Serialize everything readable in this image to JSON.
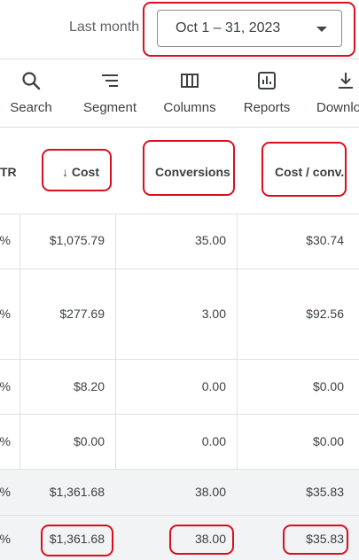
{
  "topbar": {
    "period_label": "Last month",
    "date_range": "Oct 1 – 31, 2023"
  },
  "toolbar": {
    "items": [
      {
        "label": "Search",
        "icon": "search-icon"
      },
      {
        "label": "Segment",
        "icon": "segment-icon"
      },
      {
        "label": "Columns",
        "icon": "columns-icon"
      },
      {
        "label": "Reports",
        "icon": "reports-icon"
      },
      {
        "label": "Downlo",
        "icon": "download-icon"
      }
    ]
  },
  "table": {
    "headers": {
      "ctr_partial": "TR",
      "cost": "Cost",
      "conversions": "Conversions",
      "cost_per_conv": "Cost / conv."
    },
    "rows": [
      {
        "ctr": "%",
        "cost": "$1,075.79",
        "conversions": "35.00",
        "cost_per_conv": "$30.74"
      },
      {
        "ctr": "%",
        "cost": "$277.69",
        "conversions": "3.00",
        "cost_per_conv": "$92.56"
      },
      {
        "ctr": "%",
        "cost": "$8.20",
        "conversions": "0.00",
        "cost_per_conv": "$0.00"
      },
      {
        "ctr": "%",
        "cost": "$0.00",
        "conversions": "0.00",
        "cost_per_conv": "$0.00"
      },
      {
        "ctr": "%",
        "cost": "$1,361.68",
        "conversions": "38.00",
        "cost_per_conv": "$35.83"
      },
      {
        "ctr": "%",
        "cost": "$1,361.68",
        "conversions": "38.00",
        "cost_per_conv": "$35.83"
      }
    ]
  },
  "colors": {
    "highlight": "#d90f1e",
    "total_row_bg": "#f1f3f4"
  }
}
